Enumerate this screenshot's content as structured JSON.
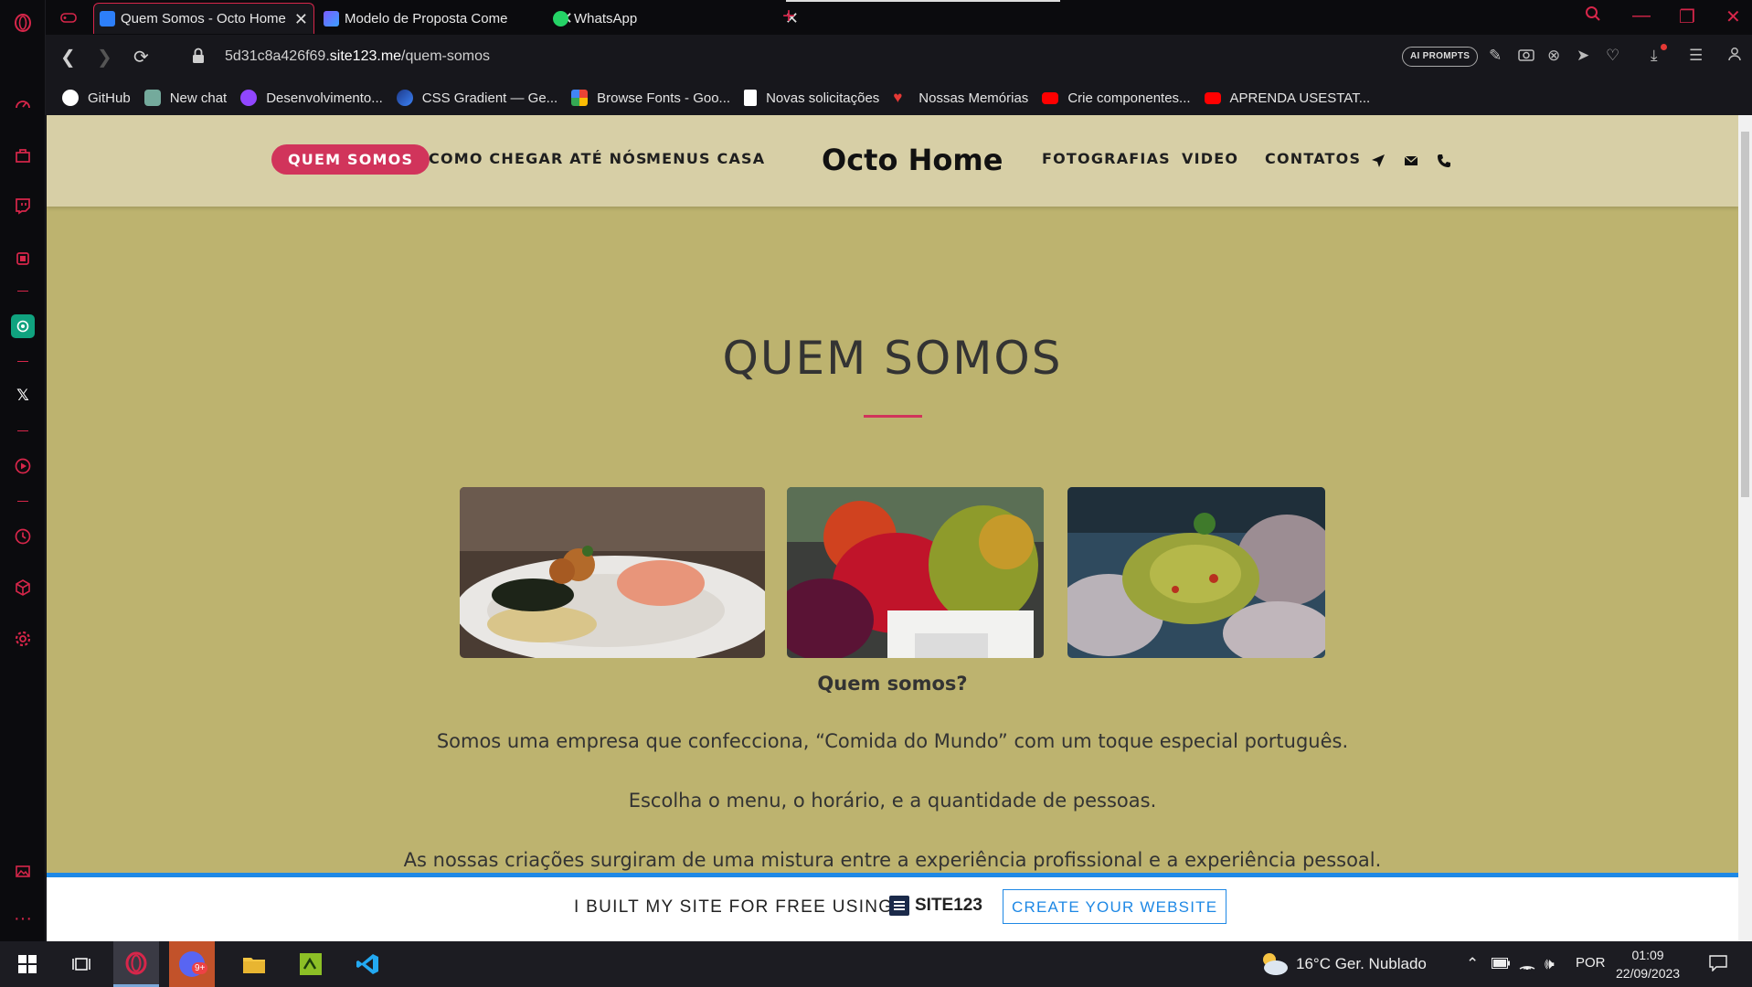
{
  "browser": {
    "tabs": [
      {
        "title": "Quem Somos - Octo Home",
        "active": true,
        "favicon_color": "#2d7ff9"
      },
      {
        "title": "Modelo de Proposta Come",
        "active": false,
        "favicon_color": "#6a5acd"
      },
      {
        "title": "WhatsApp",
        "active": false,
        "favicon_color": "#25d366"
      }
    ],
    "new_tab_symbol": "+",
    "url_prefix": "5d31c8a426f69.",
    "url_domain": "site123.me",
    "url_path": "/quem-somos",
    "ai_prompts_label": "AI PROMPTS",
    "bookmarks": [
      {
        "label": "GitHub",
        "icon": "github-icon",
        "color": "#ffffff"
      },
      {
        "label": "New chat",
        "icon": "chatgpt-icon",
        "color": "#74aa9c"
      },
      {
        "label": "Desenvolvimento...",
        "icon": "twitch-icon",
        "color": "#9146ff"
      },
      {
        "label": "CSS Gradient — Ge...",
        "icon": "gradient-icon",
        "color": "#3b82f6"
      },
      {
        "label": "Browse Fonts - Goo...",
        "icon": "google-fonts-icon",
        "color": "#fbbc04"
      },
      {
        "label": "Novas solicitações",
        "icon": "document-icon",
        "color": "#ffffff"
      },
      {
        "label": "Nossas Memórias",
        "icon": "heart-icon",
        "color": "#e53935"
      },
      {
        "label": "Crie componentes...",
        "icon": "youtube-icon",
        "color": "#ff0000"
      },
      {
        "label": "APRENDA USESTAT...",
        "icon": "youtube-icon",
        "color": "#ff0000"
      }
    ]
  },
  "site": {
    "nav_left": [
      "QUEM SOMOS",
      "COMO CHEGAR ATÉ NÓS",
      "MENUS CASA"
    ],
    "brand": "Octo Home",
    "nav_right": [
      "FOTOGRAFIAS",
      "VIDEO",
      "CONTATOS"
    ],
    "accent": "#d1345b",
    "background": "#bdb36f",
    "header_bg": "#d7cfa6",
    "section_title": "QUEM SOMOS",
    "subheading": "Quem somos?",
    "paragraphs": [
      "Somos uma empresa que confecciona, “Comida do Mundo” com um toque especial português.",
      "Escolha o menu, o horário, e a quantidade de pessoas.",
      "As nossas criações surgiram de uma mistura entre a experiência profissional e a experiência pessoal."
    ],
    "promo": {
      "text": "I BUILT MY SITE FOR FREE USING",
      "logo": "SITE123",
      "button": "CREATE YOUR WEBSITE"
    }
  },
  "taskbar": {
    "weather": "16°C  Ger. Nublado",
    "language": "POR",
    "time": "01:09",
    "date": "22/09/2023",
    "badge": "9+"
  }
}
